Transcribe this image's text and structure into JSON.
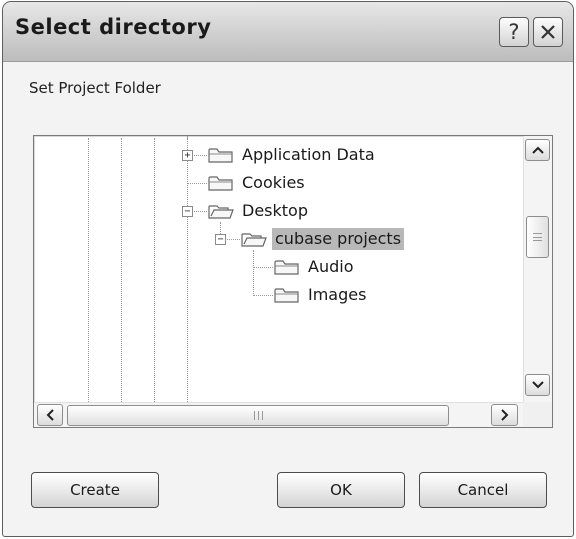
{
  "window": {
    "title": "Select directory",
    "help_label": "?",
    "close_label": "✕"
  },
  "dialog": {
    "subtitle": "Set Project Folder"
  },
  "tree": {
    "nodes": [
      {
        "label": "Application Data",
        "expander": "+"
      },
      {
        "label": "Cookies"
      },
      {
        "label": "Desktop",
        "expander": "−"
      },
      {
        "label": "cubase projects",
        "expander": "−",
        "selected": true
      },
      {
        "label": "Audio"
      },
      {
        "label": "Images"
      }
    ]
  },
  "scrollbars": {
    "vertical": {
      "up_icon": "▲",
      "down_icon": "▼"
    },
    "horizontal": {
      "left_icon": "◀",
      "right_icon": "▶"
    }
  },
  "buttons": {
    "create": "Create",
    "ok": "OK",
    "cancel": "Cancel"
  }
}
